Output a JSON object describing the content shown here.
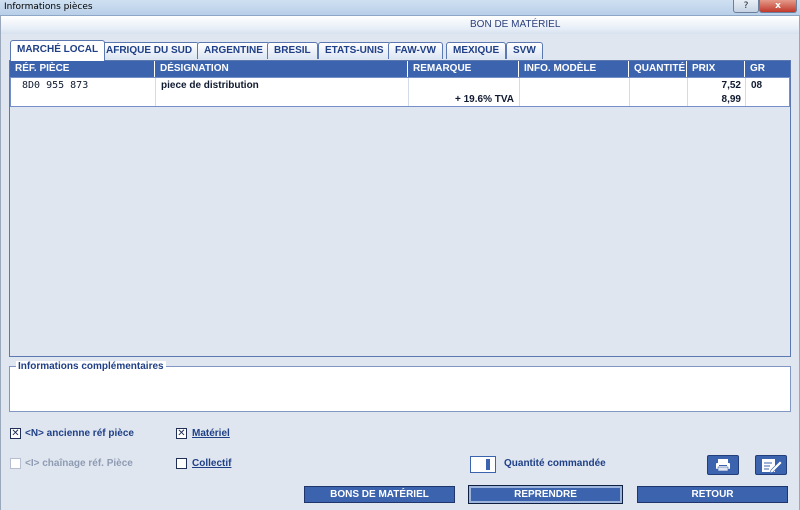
{
  "window": {
    "title": "Informations pièces",
    "help_label": "?",
    "close_label": "x"
  },
  "header": {
    "title": "BON DE MATÉRIEL"
  },
  "tabs": [
    {
      "label": "MARCHÉ LOCAL",
      "active": true
    },
    {
      "label": "AFRIQUE DU SUD"
    },
    {
      "label": "ARGENTINE"
    },
    {
      "label": "BRESIL"
    },
    {
      "label": "ETATS-UNIS"
    },
    {
      "label": "FAW-VW"
    },
    {
      "label": "MEXIQUE"
    },
    {
      "label": "SVW"
    }
  ],
  "table": {
    "columns": [
      "RÉF. PIÈCE",
      "DÉSIGNATION",
      "REMARQUE",
      "INFO. MODÈLE",
      "QUANTITÉ",
      "PRIX",
      "GR"
    ],
    "rows": [
      {
        "ref": "8D0 955 873",
        "designation": "piece de distribution",
        "remarque": "+ 19.6% TVA",
        "info_modele": "",
        "quantite": "",
        "prix": "7,52",
        "prix_ttc": "8,99",
        "gr": "08"
      }
    ]
  },
  "info": {
    "label": "Informations complémentaires",
    "value": ""
  },
  "options": {
    "ancienne_ref": {
      "label": "<N> ancienne réf pièce",
      "checked": true
    },
    "chainage_ref": {
      "label": "<I> chaînage réf. Pièce",
      "checked": false,
      "disabled": true
    },
    "materiel": {
      "label": "Matériel",
      "checked": true
    },
    "collectif": {
      "label": "Collectif",
      "checked": false
    }
  },
  "quantity": {
    "label": "Quantité commandée",
    "value": ""
  },
  "icons": {
    "print": "printer-icon",
    "edit": "edit-icon"
  },
  "buttons": {
    "bons": "BONS DE MATÉRIEL",
    "reprendre": "REPRENDRE",
    "retour": "RETOUR"
  }
}
